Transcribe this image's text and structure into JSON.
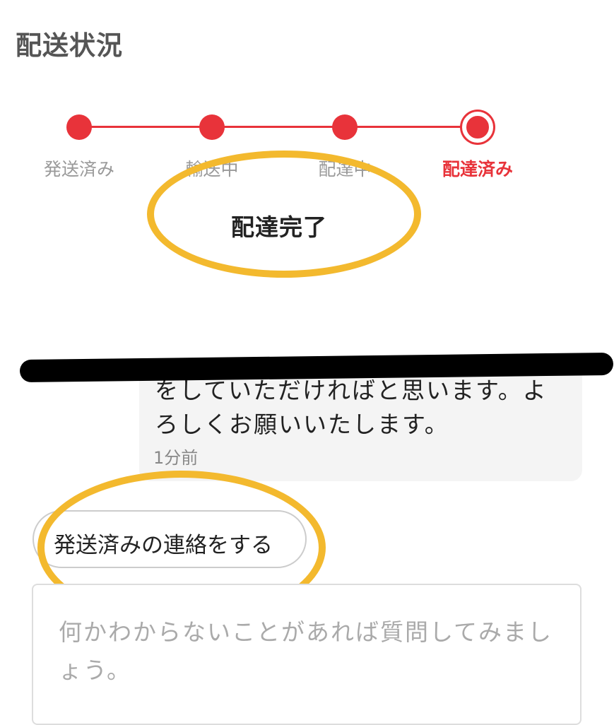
{
  "section_title": "配送状況",
  "stepper": {
    "steps": [
      {
        "label": "発送済み",
        "state": "done"
      },
      {
        "label": "輸送中",
        "state": "done"
      },
      {
        "label": "配達中",
        "state": "done"
      },
      {
        "label": "配達済み",
        "state": "current"
      }
    ],
    "active_color": "#e8333a",
    "inactive_label_color": "#999999"
  },
  "status": {
    "text": "配達完了"
  },
  "message": {
    "partial_line": "をしていただければと思います。よ",
    "line": "ろしくお願いいたします。",
    "time": "1分前"
  },
  "action": {
    "label": "発送済みの連絡をする"
  },
  "question": {
    "placeholder": "何かわからないことがあれば質問してみましょう。"
  },
  "annotation_color": "#f3b92e"
}
